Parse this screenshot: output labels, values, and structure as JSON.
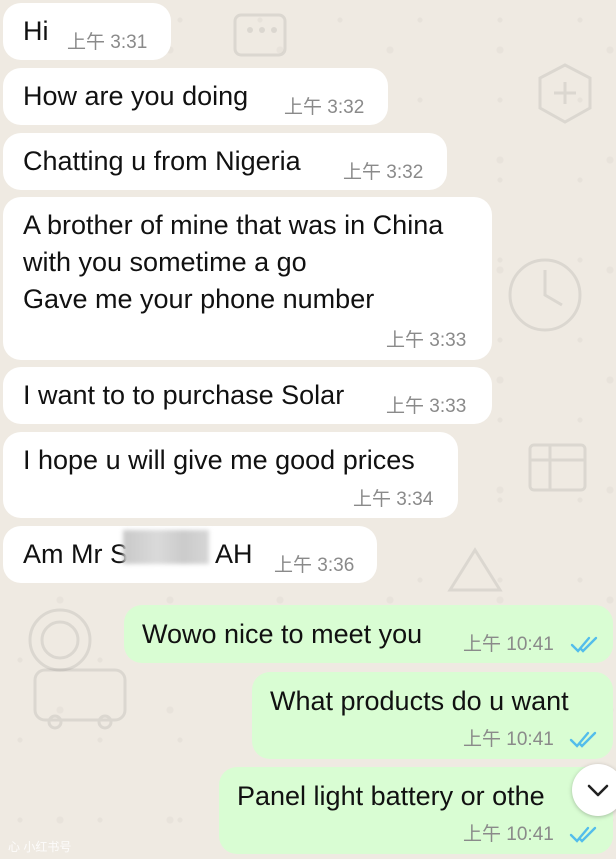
{
  "messages": [
    {
      "direction": "incoming",
      "text": "Hi",
      "time": "上午 3:31"
    },
    {
      "direction": "incoming",
      "text": "How are you doing",
      "time": "上午 3:32"
    },
    {
      "direction": "incoming",
      "text": "Chatting u from Nigeria",
      "time": "上午 3:32"
    },
    {
      "direction": "incoming",
      "text": "A brother of mine that was in China\nwith you sometime a go\nGave me your phone number",
      "time": "上午 3:33"
    },
    {
      "direction": "incoming",
      "text": "I want to to purchase Solar",
      "time": "上午 3:33"
    },
    {
      "direction": "incoming",
      "text": "I hope u will give me good prices",
      "time": "上午 3:34"
    },
    {
      "direction": "incoming",
      "text_prefix": "Am Mr S",
      "text_suffix": "AH",
      "time": "上午 3:36"
    },
    {
      "direction": "outgoing",
      "text": "Wowo nice to meet you",
      "time": "上午 10:41",
      "status": "read"
    },
    {
      "direction": "outgoing",
      "text": "What products do u want",
      "time": "上午 10:41",
      "status": "read"
    },
    {
      "direction": "outgoing",
      "text": "Panel light battery or othe",
      "time": "上午 10:41",
      "status": "read"
    }
  ],
  "colors": {
    "incoming_bubble": "#ffffff",
    "outgoing_bubble": "#d9fdd3",
    "read_ticks": "#53bdeb",
    "chat_background": "#efeae2"
  },
  "scroll_button": {
    "icon": "chevron-down-icon"
  },
  "watermark": "心 小红书号"
}
